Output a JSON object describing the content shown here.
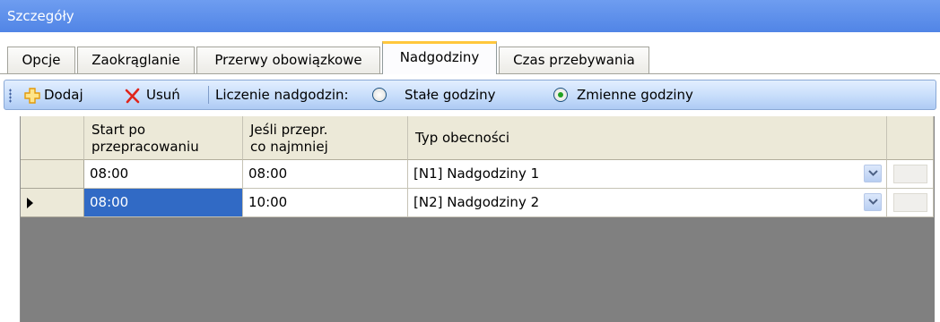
{
  "window": {
    "title": "Szczegóły"
  },
  "tabs": [
    {
      "label": "Opcje"
    },
    {
      "label": "Zaokrąglanie"
    },
    {
      "label": "Przerwy obowiązkowe"
    },
    {
      "label": "Nadgodziny",
      "active": true
    },
    {
      "label": "Czas przebywania"
    }
  ],
  "toolbar": {
    "add_label": "Dodaj",
    "delete_label": "Usuń",
    "mode_label": "Liczenie nadgodzin:",
    "options": [
      {
        "label": "Stałe godziny",
        "checked": false
      },
      {
        "label": "Zmienne godziny",
        "checked": true
      }
    ],
    "icons": {
      "add": "add-icon",
      "delete": "delete-icon"
    },
    "colors": {
      "add_icon": "#f5a30d",
      "delete_icon": "#e0251b"
    }
  },
  "grid": {
    "columns": [
      {
        "line1": "Start po",
        "line2": "przepracowaniu"
      },
      {
        "line1": "Jeśli przepr.",
        "line2": "co najmniej"
      },
      {
        "line1": "Typ obecności",
        "line2": ""
      }
    ],
    "rows": [
      {
        "start": "08:00",
        "min": "08:00",
        "type": "[N1]  Nadgodziny 1",
        "current": false,
        "selected_col": null
      },
      {
        "start": "08:00",
        "min": "10:00",
        "type": "[N2]  Nadgodziny 2",
        "current": true,
        "selected_col": "start"
      }
    ],
    "colors": {
      "selection": "#316ac5",
      "empty_area": "#808080"
    }
  }
}
